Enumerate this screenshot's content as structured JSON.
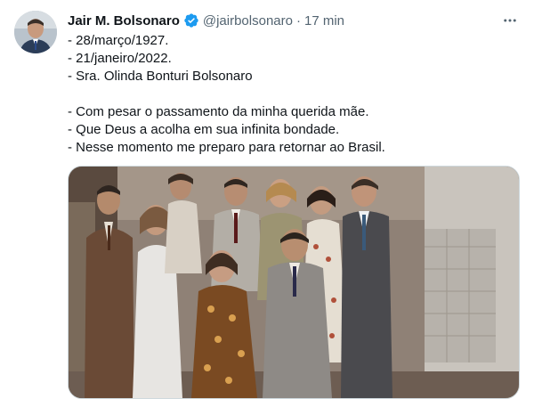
{
  "tweet": {
    "author_name": "Jair M. Bolsonaro",
    "handle": "@jairbolsonaro",
    "separator": "·",
    "time": "17 min",
    "lines": [
      "- 28/março/1927.",
      "- 21/janeiro/2022.",
      "- Sra. Olinda Bonturi Bolsonaro",
      "",
      "- Com pesar o passamento da minha querida mãe.",
      "- Que Deus a acolha em sua infinita bondade.",
      "- Nesse momento me preparo para retornar ao Brasil."
    ]
  },
  "icons": {
    "verified": "verified-badge-icon",
    "more": "more-options-icon"
  },
  "colors": {
    "verified_blue": "#1d9bf0",
    "secondary_text": "#536471",
    "primary_text": "#0f1419"
  }
}
